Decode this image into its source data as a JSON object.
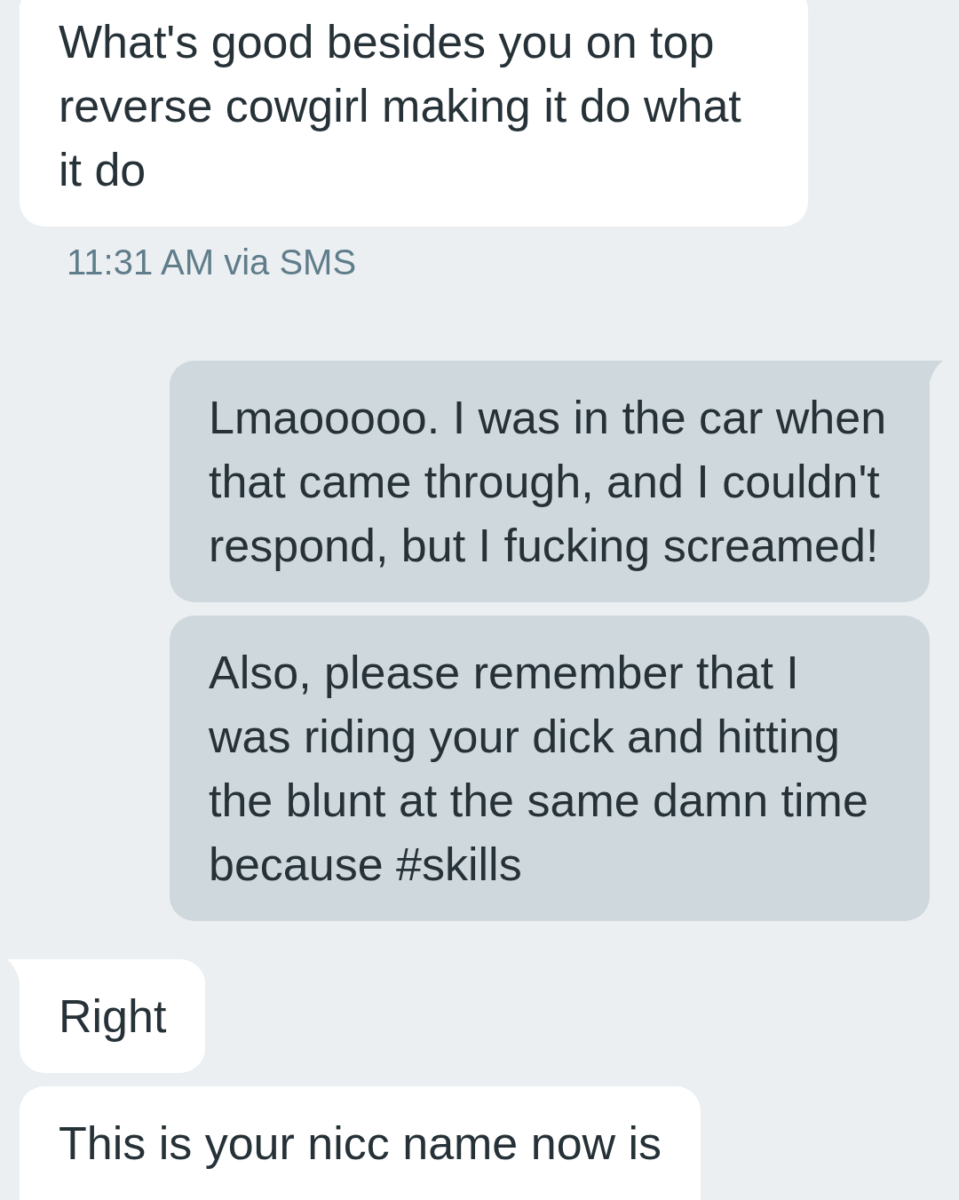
{
  "messages": [
    {
      "kind": "incoming",
      "tail": false,
      "text": "What's good besides you on top reverse cowgirl making it do what it do",
      "meta": "11:31 AM via SMS"
    },
    {
      "kind": "outgoing",
      "tail": true,
      "text": "Lmaooooo. I was in the car when that came through, and I couldn't respond, but I fucking screamed!"
    },
    {
      "kind": "outgoing",
      "tail": false,
      "text": "Also, please remember that I was riding your dick and hitting the blunt at the same damn time because #skills"
    },
    {
      "kind": "incoming",
      "tail": true,
      "text": "Right"
    },
    {
      "kind": "incoming",
      "tail": false,
      "text": "This is your nicc name now is"
    }
  ]
}
